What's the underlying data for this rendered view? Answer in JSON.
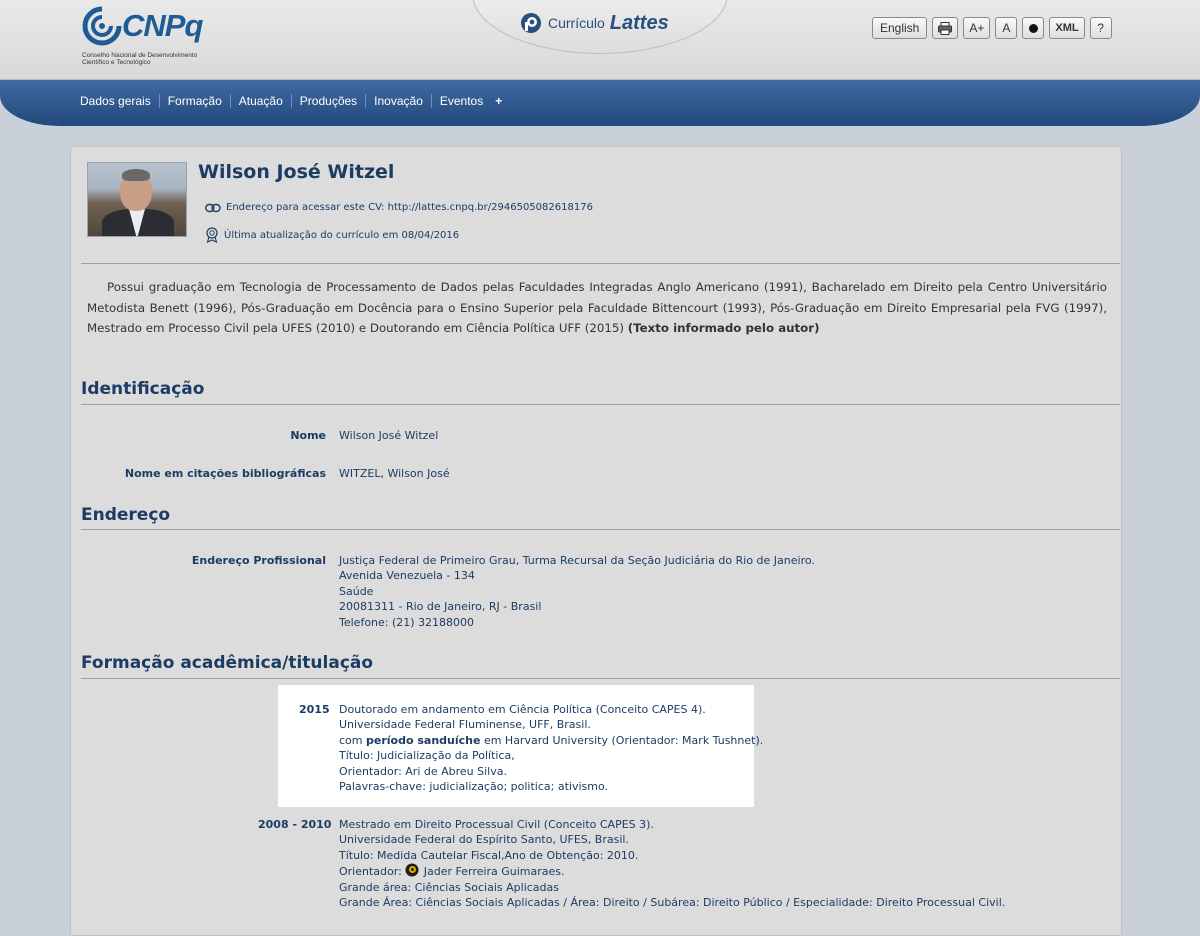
{
  "header": {
    "logo": {
      "name": "CNPq",
      "subtitle_line1": "Conselho Nacional de Desenvolvimento",
      "subtitle_line2": "Científico e Tecnológico"
    },
    "app_title_a": "Currículo",
    "app_title_b": "Lattes",
    "tools": {
      "language": "English",
      "print_icon": "printer-icon",
      "font_increase": "A+",
      "font_reset": "A",
      "contrast_icon": "contrast-icon",
      "xml": "XML",
      "help": "?"
    }
  },
  "nav": {
    "items": [
      "Dados gerais",
      "Formação",
      "Atuação",
      "Produções",
      "Inovação",
      "Eventos"
    ],
    "more": "+"
  },
  "profile": {
    "name": "Wilson José Witzel",
    "cv_url_label": "Endereço para acessar este CV: http://lattes.cnpq.br/2946505082618176",
    "last_update": "Última atualização do currículo em 08/04/2016"
  },
  "resumo": {
    "text": "Possui graduação em Tecnologia de Processamento de Dados pelas Faculdades Integradas Anglo Americano (1991), Bacharelado em Direito pela Centro Universitário Metodista Benett (1996), Pós-Graduação em Docência para o Ensino Superior pela Faculdade Bittencourt (1993), Pós-Graduação em Direito Empresarial pela FVG (1997), Mestrado em Processo Civil pela UFES (2010) e Doutorando em Ciência Política UFF (2015)",
    "note": "(Texto informado pelo autor)"
  },
  "identificacao": {
    "title": "Identificação",
    "nome_label": "Nome",
    "nome_value": "Wilson José Witzel",
    "citacao_label": "Nome em citações bibliográficas",
    "citacao_value": "WITZEL, Wilson José"
  },
  "endereco": {
    "title": "Endereço",
    "label": "Endereço Profissional",
    "lines": [
      "Justiça Federal de Primeiro Grau, Turma Recursal da Seção Judiciária do Rio de Janeiro.",
      "Avenida Venezuela - 134",
      "Saúde",
      "20081311 - Rio de Janeiro, RJ - Brasil",
      "Telefone: (21) 32188000"
    ]
  },
  "formacao": {
    "title": "Formação acadêmica/titulação",
    "entries": [
      {
        "year": "2015",
        "line1": "Doutorado em andamento em Ciência Política (Conceito CAPES 4).",
        "line2": "Universidade Federal Fluminense, UFF, Brasil.",
        "line3_pre": "com",
        "line3_bold": "período sanduíche",
        "line3_post": "em Harvard University (Orientador: Mark Tushnet).",
        "line4": "Título: Judicialização da Política,",
        "line5": "Orientador: Ari de Abreu Silva.",
        "line6": "Palavras-chave: judicialização; politica; ativismo."
      },
      {
        "year": "2008 - 2010",
        "line1": "Mestrado em Direito Processual Civil (Conceito CAPES 3).",
        "line2": "Universidade Federal do Espírito Santo, UFES, Brasil.",
        "line3": "Título: Medida Cautelar Fiscal,Ano de Obtenção: 2010.",
        "line4_pre": "Orientador:",
        "line4_post": "Jader Ferreira Guimaraes.",
        "line5": "Grande área: Ciências Sociais Aplicadas",
        "line6": "Grande Área: Ciências Sociais Aplicadas / Área: Direito / Subárea: Direito Público / Especialidade: Direito Processual Civil."
      }
    ]
  }
}
